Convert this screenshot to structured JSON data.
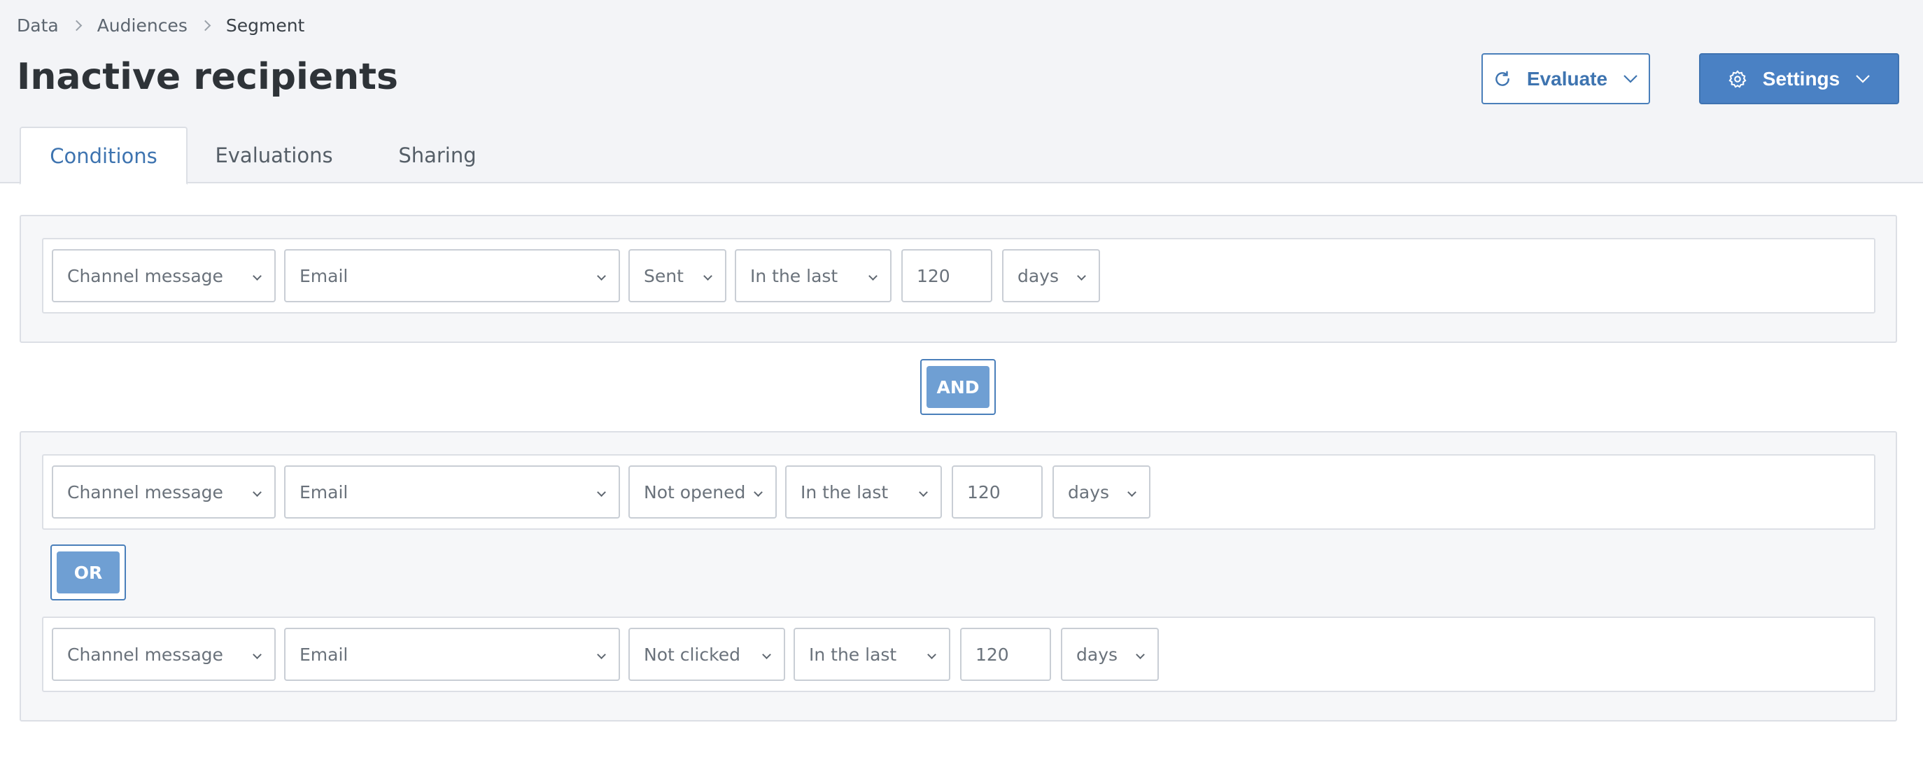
{
  "breadcrumb": [
    "Data",
    "Audiences",
    "Segment"
  ],
  "page_title": "Inactive recipients",
  "buttons": {
    "evaluate": {
      "label": "Evaluate",
      "icon": "refresh-icon"
    },
    "settings": {
      "label": "Settings",
      "icon": "gear-icon"
    }
  },
  "tabs": [
    "Conditions",
    "Evaluations",
    "Sharing"
  ],
  "active_tab": "Conditions",
  "groups": [
    {
      "conditions": [
        {
          "source": "Channel message",
          "channel": "Email",
          "event": "Sent",
          "operator": "In the last",
          "value": "120",
          "unit": "days"
        }
      ]
    },
    {
      "joiner": "OR",
      "conditions": [
        {
          "source": "Channel message",
          "channel": "Email",
          "event": "Not opened",
          "operator": "In the last",
          "value": "120",
          "unit": "days"
        },
        {
          "source": "Channel message",
          "channel": "Email",
          "event": "Not clicked",
          "operator": "In the last",
          "value": "120",
          "unit": "days"
        }
      ]
    }
  ],
  "group_joiner": "AND",
  "colors": {
    "accent": "#4a81c4",
    "logic_button": "#6f9fd3",
    "header_bg": "#f3f4f7",
    "border": "#dcdfe5"
  }
}
